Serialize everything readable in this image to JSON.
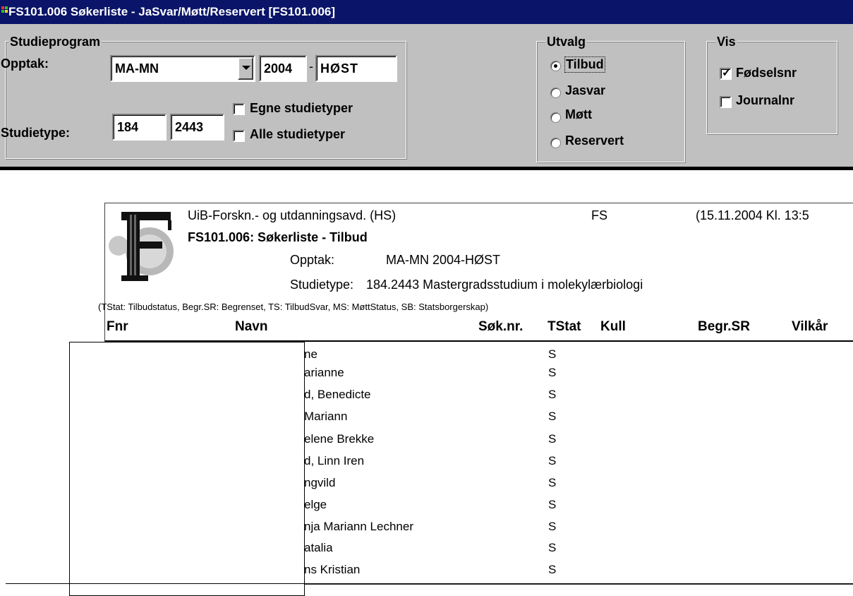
{
  "window": {
    "title": "FS101.006 Søkerliste - JaSvar/Møtt/Reservert  [FS101.006]"
  },
  "studieprogram": {
    "legend": "Studieprogram",
    "opptak_label": "Opptak:",
    "opptak_value": "MA-MN",
    "year": "2004",
    "dash": "-",
    "term": "HØST",
    "studietype_label": "Studietype:",
    "studietype_1": "184",
    "studietype_2": "2443",
    "egne_label": "Egne studietyper",
    "alle_label": "Alle studietyper"
  },
  "utvalg": {
    "legend": "Utvalg",
    "options": [
      {
        "label": "Tilbud",
        "selected": true
      },
      {
        "label": "Jasvar",
        "selected": false
      },
      {
        "label": "Møtt",
        "selected": false
      },
      {
        "label": "Reservert",
        "selected": false
      }
    ]
  },
  "vis": {
    "legend": "Vis",
    "fodselsnr_label": "Fødselsnr",
    "fodselsnr_checked": true,
    "journalnr_label": "Journalnr",
    "journalnr_checked": false
  },
  "report": {
    "institution": "UiB-Forskn.- og utdanningsavd. (HS)",
    "system": "FS",
    "datetime": "(15.11.2004 Kl. 13:5",
    "title": "FS101.006: Søkerliste - Tilbud",
    "opptak_label": "Opptak:",
    "opptak_value": "MA-MN 2004-HØST",
    "studietype_label": "Studietype:",
    "studietype_value": "184.2443 Mastergradsstudium i molekylærbiologi",
    "legend_note": "(TStat: Tilbudstatus, Begr.SR: Begrenset, TS: TilbudSvar, MS: MøttStatus, SB: Statsborgerskap)",
    "columns": {
      "fnr": "Fnr",
      "navn": "Navn",
      "soknr": "Søk.nr.",
      "tstat": "TStat",
      "kull": "Kull",
      "begr": "Begr.SR",
      "vilkar": "Vilkår"
    },
    "rows": [
      {
        "name": "ne",
        "tstat": "S"
      },
      {
        "name": "arianne",
        "tstat": "S"
      },
      {
        "name": "d, Benedicte",
        "tstat": "S"
      },
      {
        "name": "Mariann",
        "tstat": "S"
      },
      {
        "name": "elene Brekke",
        "tstat": "S"
      },
      {
        "name": "d, Linn Iren",
        "tstat": "S"
      },
      {
        "name": "ngvild",
        "tstat": "S"
      },
      {
        "name": "elge",
        "tstat": "S"
      },
      {
        "name": "nja Mariann Lechner",
        "tstat": "S"
      },
      {
        "name": "atalia",
        "tstat": "S"
      },
      {
        "name": "ns Kristian",
        "tstat": "S"
      }
    ]
  }
}
